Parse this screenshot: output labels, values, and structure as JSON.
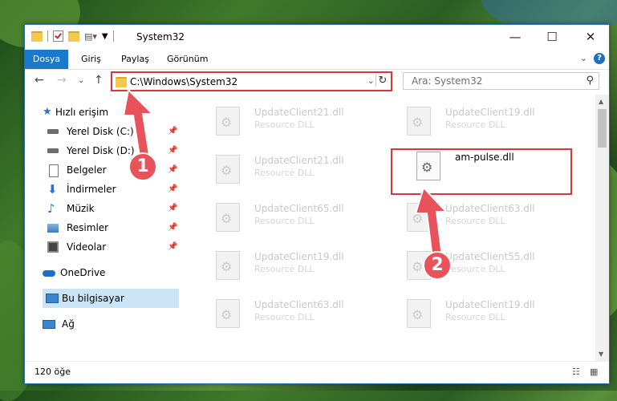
{
  "window": {
    "title": "System32",
    "minimize_label": "—",
    "maximize_label": "☐",
    "close_label": "✕"
  },
  "ribbon": {
    "tabs": [
      "Dosya",
      "Giriş",
      "Paylaş",
      "Görünüm"
    ],
    "help_label": "?"
  },
  "address": {
    "path": "C:\\Windows\\System32"
  },
  "search": {
    "placeholder": "Ara: System32"
  },
  "sidebar": {
    "items": [
      {
        "label": "Hızlı erişim",
        "icon": "star-icon"
      },
      {
        "label": "Yerel Disk (C:)",
        "icon": "drive-icon"
      },
      {
        "label": "Yerel Disk (D:)",
        "icon": "drive-icon"
      },
      {
        "label": "Belgeler",
        "icon": "documents-icon"
      },
      {
        "label": "İndirmeler",
        "icon": "download-icon"
      },
      {
        "label": "Müzik",
        "icon": "music-icon"
      },
      {
        "label": "Resimler",
        "icon": "pictures-icon"
      },
      {
        "label": "Videolar",
        "icon": "videos-icon"
      },
      {
        "label": "OneDrive",
        "icon": "cloud-icon"
      },
      {
        "label": "Bu bilgisayar",
        "icon": "computer-icon"
      },
      {
        "label": "Ağ",
        "icon": "network-icon"
      }
    ]
  },
  "files": [
    {
      "name": "UpdateClient21.dll",
      "desc": "Resource DLL"
    },
    {
      "name": "UpdateClient19.dll",
      "desc": "Resource DLL"
    },
    {
      "name": "UpdateClient21.dll",
      "desc": "Resource DLL"
    },
    {
      "name": "am-pulse.dll",
      "desc": ""
    },
    {
      "name": "UpdateClient65.dll",
      "desc": "Resource DLL"
    },
    {
      "name": "UpdateClient63.dll",
      "desc": "Resource DLL"
    },
    {
      "name": "UpdateClient19.dll",
      "desc": "Resource DLL"
    },
    {
      "name": "UpdateClient55.dll",
      "desc": "Resource DLL"
    },
    {
      "name": "UpdateClient63.dll",
      "desc": "Resource DLL"
    },
    {
      "name": "UpdateClient19.dll",
      "desc": "Resource DLL"
    }
  ],
  "status": {
    "count": "120 öğe"
  },
  "annotations": {
    "step1": "1",
    "step2": "2",
    "color": "#e8525a"
  }
}
